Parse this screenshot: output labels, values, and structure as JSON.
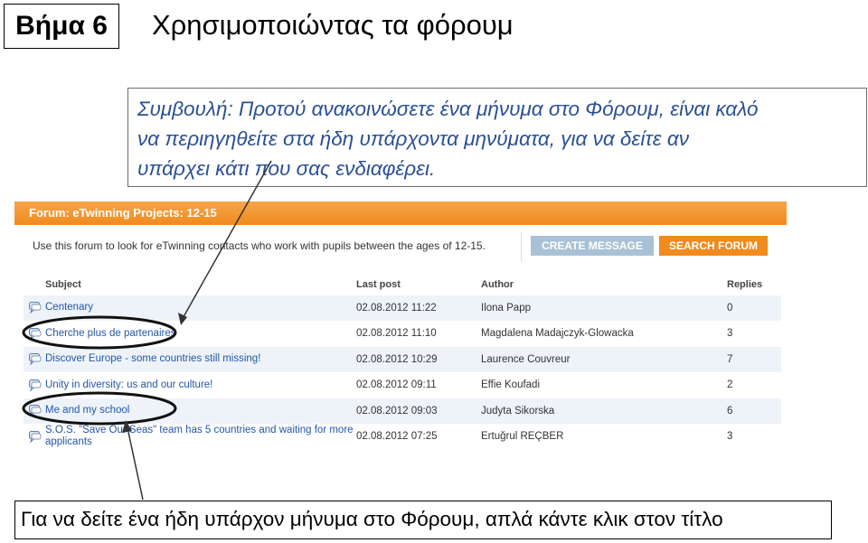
{
  "slide": {
    "step": "Βήμα 6",
    "title": "Χρησιμοποιώντας τα φόρουμ",
    "tip_lines": [
      "Συμβουλή: Προτού ανακοινώσετε ένα μήνυμα στο Φόρουμ, είναι καλό",
      "να περιηγηθείτε στα ήδη υπάρχοντα μηνύματα, για να δείτε αν",
      "υπάρχει κάτι που σας ενδιαφέρει."
    ],
    "callout": "Για να δείτε ένα ήδη υπάρχον μήνυμα στο Φόρουμ, απλά κάντε κλικ στον τίτλο"
  },
  "forum": {
    "header": "Forum: eTwinning Projects: 12-15",
    "description": "Use this forum to look for eTwinning contacts who work with pupils between the ages of 12-15.",
    "create_label": "CREATE MESSAGE",
    "search_label": "SEARCH FORUM",
    "columns": [
      "Subject",
      "Last post",
      "Author",
      "Replies"
    ],
    "threads": [
      {
        "subject": "Centenary",
        "last_post": "02.08.2012 11:22",
        "author": "Ilona Papp",
        "replies": "0"
      },
      {
        "subject": "Cherche plus de partenaires",
        "last_post": "02.08.2012 11:10",
        "author": "Magdalena Madajczyk-Glowacka",
        "replies": "3"
      },
      {
        "subject": "Discover Europe - some countries still missing!",
        "last_post": "02.08.2012 10:29",
        "author": "Laurence Couvreur",
        "replies": "7"
      },
      {
        "subject": "Unity in diversity: us and our culture!",
        "last_post": "02.08.2012 09:11",
        "author": "Effie Koufadi",
        "replies": "2"
      },
      {
        "subject": "Me and my school",
        "last_post": "02.08.2012 09:03",
        "author": "Judyta Sikorska",
        "replies": "6"
      },
      {
        "subject": "S.O.S. \"Save Our Seas\" team has 5 countries and waiting for more applicants",
        "last_post": "02.08.2012 07:25",
        "author": "Ertuğrul REÇBER",
        "replies": "3"
      }
    ]
  },
  "colors": {
    "accent_orange": "#ef8a1e",
    "link_blue": "#2356a8",
    "tip_text": "#2a4f93"
  },
  "icons": {
    "topic": "speech-bubble-icon"
  }
}
